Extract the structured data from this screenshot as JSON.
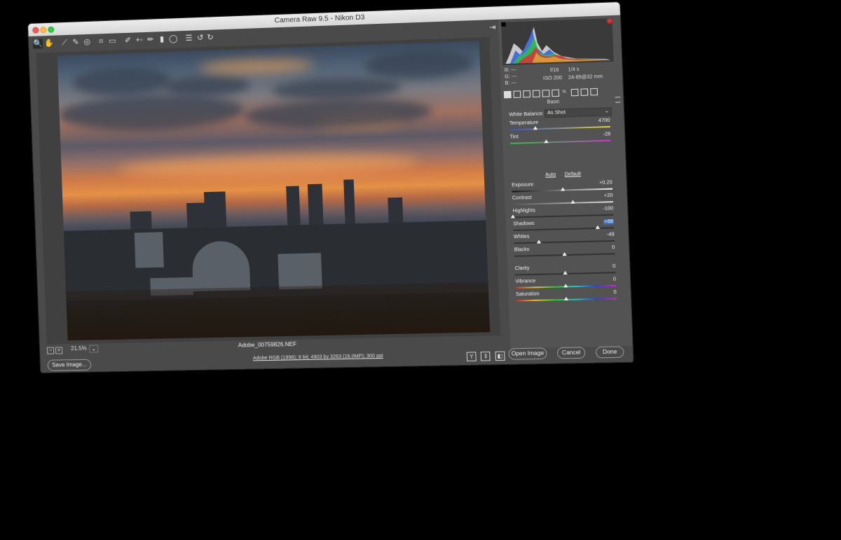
{
  "window": {
    "title": "Camera Raw 9.5  -  Nikon D3"
  },
  "toolbar": {
    "tools": [
      {
        "name": "zoom-tool",
        "glyph": "🔍"
      },
      {
        "name": "hand-tool",
        "glyph": "✋"
      },
      {
        "name": "white-balance-tool",
        "glyph": "⟋"
      },
      {
        "name": "color-sampler-tool",
        "glyph": "✎"
      },
      {
        "name": "targeted-adjustment-tool",
        "glyph": "◎"
      },
      {
        "name": "crop-tool",
        "glyph": "⌗"
      },
      {
        "name": "straighten-tool",
        "glyph": "▭"
      },
      {
        "name": "spot-removal-tool",
        "glyph": "✐"
      },
      {
        "name": "red-eye-tool",
        "glyph": "+◦"
      },
      {
        "name": "adjustment-brush-tool",
        "glyph": "✏"
      },
      {
        "name": "graduated-filter-tool",
        "glyph": "▮"
      },
      {
        "name": "radial-filter-tool",
        "glyph": "◯"
      },
      {
        "name": "preferences-tool",
        "glyph": "☰"
      },
      {
        "name": "rotate-left-tool",
        "glyph": "↺"
      },
      {
        "name": "rotate-right-tool",
        "glyph": "↻"
      }
    ],
    "export_glyph": "⇥"
  },
  "status": {
    "zoom_minus": "−",
    "zoom_plus": "+",
    "zoom_level": "21.5%",
    "zoom_arrow": "⌄",
    "filename": "Adobe_00759826.NEF"
  },
  "view_icons": [
    "Y",
    "⇕",
    "◧",
    "☰"
  ],
  "bottom": {
    "save_label": "Save Image...",
    "workflow": "Adobe RGB (1998); 8 bit; 4903 by 3263 (16.0MP); 300 ppi",
    "open_label": "Open Image",
    "cancel_label": "Cancel",
    "done_label": "Done"
  },
  "readout": {
    "r": "R:   ---",
    "g": "G:   ---",
    "b": "B:   ---",
    "aperture": "f/16",
    "shutter": "1/4 s",
    "iso": "ISO 200",
    "lens": "24-85@32 mm"
  },
  "panel": {
    "section_title": "Basic",
    "white_balance_label": "White Balance:",
    "white_balance_value": "As Shot",
    "auto_label": "Auto",
    "default_label": "Default"
  },
  "sliders": {
    "temperature": {
      "label": "Temperature",
      "value": "4700",
      "level": 0.26
    },
    "tint": {
      "label": "Tint",
      "value": "-28",
      "level": 0.36
    },
    "exposure": {
      "label": "Exposure",
      "value": "+0.20",
      "level": 0.51
    },
    "contrast": {
      "label": "Contrast",
      "value": "+20",
      "level": 0.6
    },
    "highlights": {
      "label": "Highlights",
      "value": "-100",
      "level": 0.0
    },
    "shadows": {
      "label": "Shadows",
      "value": "+68",
      "level": 0.84
    },
    "whites": {
      "label": "Whites",
      "value": "-49",
      "level": 0.25
    },
    "blacks": {
      "label": "Blacks",
      "value": "0",
      "level": 0.5
    },
    "clarity": {
      "label": "Clarity",
      "value": "0",
      "level": 0.5
    },
    "vibrance": {
      "label": "Vibrance",
      "value": "0",
      "level": 0.5
    },
    "saturation": {
      "label": "Saturation",
      "value": "0",
      "level": 0.5
    }
  },
  "colors": {
    "window_bg": "#4a4a4a",
    "panel_bg": "#535353",
    "highlight": "#3a72c4",
    "clip_warning": "#d93030"
  }
}
